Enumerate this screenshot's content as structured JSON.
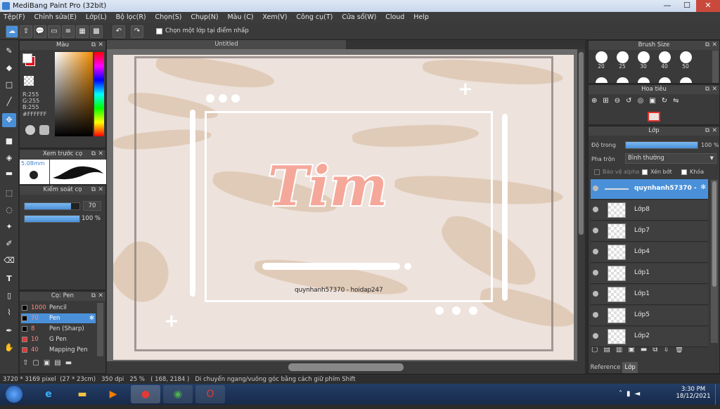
{
  "app": {
    "title": "MediBang Paint Pro (32bit)"
  },
  "window_controls": {
    "minimize": "—",
    "maximize": "☐",
    "close": "✕"
  },
  "menu": [
    "Tệp(F)",
    "Chỉnh sửa(E)",
    "Lớp(L)",
    "Bộ lọc(R)",
    "Chọn(S)",
    "Chụp(N)",
    "Màu (C)",
    "Xem(V)",
    "Công cụ(T)",
    "Cửa sổ(W)",
    "Cloud",
    "Help"
  ],
  "toolbar": {
    "select_layer_label": "Chọn một lớp tại điểm nhấp"
  },
  "document": {
    "tab_title": "Untitled"
  },
  "color_panel": {
    "title": "Màu",
    "r": "R:255",
    "g": "G:255",
    "b": "B:255",
    "hex": "#FFFFFF",
    "primary": "#ffffff",
    "secondary": "#e60012"
  },
  "brush_preview": {
    "title": "Xem trước cọ",
    "size": "5.08mm"
  },
  "brush_control": {
    "title": "Kiểm soát cọ",
    "size_value": "70",
    "size_level": 0.85,
    "opacity_value": "100 %",
    "opacity_level": 1.0
  },
  "brush_list": {
    "title": "Cọ: Pen",
    "items": [
      {
        "size": "1000",
        "name": "Pencil",
        "color": "#000000",
        "selected": false
      },
      {
        "size": "70",
        "name": "Pen",
        "color": "#000000",
        "selected": true
      },
      {
        "size": "8",
        "name": "Pen (Sharp)",
        "color": "#000000",
        "selected": false
      },
      {
        "size": "10",
        "name": "G Pen",
        "color": "#e53935",
        "selected": false
      },
      {
        "size": "40",
        "name": "Mapping Pen",
        "color": "#e53935",
        "selected": false
      }
    ]
  },
  "brush_size_panel": {
    "title": "Brush Size",
    "sizes": [
      "20",
      "25",
      "30",
      "40",
      "50"
    ]
  },
  "navigator": {
    "title": "Hoa tiêu"
  },
  "layer_panel": {
    "title": "Lớp",
    "opacity_label": "Độ trong",
    "opacity_value": "100 %",
    "blend_label": "Pha trộn",
    "blend_value": "Bình thường",
    "protect_alpha": "Bảo vệ alpha",
    "clipping": "Xén bớt",
    "lock": "Khóa",
    "layers": [
      {
        "name": "quynhanh57370 -",
        "selected": true
      },
      {
        "name": "Lớp8",
        "selected": false
      },
      {
        "name": "Lớp7",
        "selected": false
      },
      {
        "name": "Lớp4",
        "selected": false
      },
      {
        "name": "Lớp1",
        "selected": false
      },
      {
        "name": "Lớp1",
        "selected": false
      },
      {
        "name": "Lớp5",
        "selected": false
      },
      {
        "name": "Lớp2",
        "selected": false
      }
    ],
    "tab_reference": "Reference",
    "tab_layer": "Lớp"
  },
  "artwork": {
    "main_text": "Tim",
    "signature": "quynhanh57370 - hoidap247"
  },
  "status": {
    "pixels": "3720 * 3169 pixel",
    "cm": "(27 * 23cm)",
    "dpi": "350 dpi",
    "zoom": "25 %",
    "coords": "( 168, 2184 )",
    "hint": "Di chuyển ngang/vuông góc bằng cách giữ phím Shift"
  },
  "taskbar": {
    "time": "3:30 PM",
    "date": "18/12/2021"
  },
  "colors": {
    "panel_bg": "#3a3a3a",
    "accent": "#4a90d9",
    "selection": "#5b9bd5"
  }
}
